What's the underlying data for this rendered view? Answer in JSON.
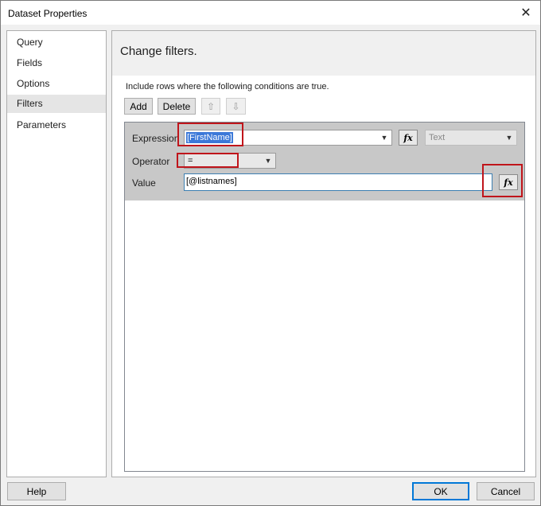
{
  "window": {
    "title": "Dataset Properties",
    "close_glyph": "✕"
  },
  "nav": {
    "items": [
      {
        "label": "Query"
      },
      {
        "label": "Fields"
      },
      {
        "label": "Options"
      },
      {
        "label": "Filters",
        "selected": true
      },
      {
        "label": "Parameters"
      }
    ]
  },
  "content": {
    "title": "Change filters.",
    "instruction": "Include rows where the following conditions are true.",
    "toolbar": {
      "add_label": "Add",
      "delete_label": "Delete",
      "up_icon": "⇧",
      "down_icon": "⇩"
    },
    "filter": {
      "expression_label": "Expression",
      "expression_value": "[FirstName]",
      "type_value": "Text",
      "operator_label": "Operator",
      "operator_value": "=",
      "value_label": "Value",
      "value_value": "[@listnames]",
      "fx_label": "fx"
    }
  },
  "footer": {
    "help_label": "Help",
    "ok_label": "OK",
    "cancel_label": "Cancel"
  },
  "colors": {
    "highlight": "#c0151b",
    "selection": "#3b78d8",
    "default_button_border": "#0078d7"
  },
  "icons": {
    "close": "close-icon",
    "expand": "chevron-down-icon",
    "function": "function-icon"
  }
}
